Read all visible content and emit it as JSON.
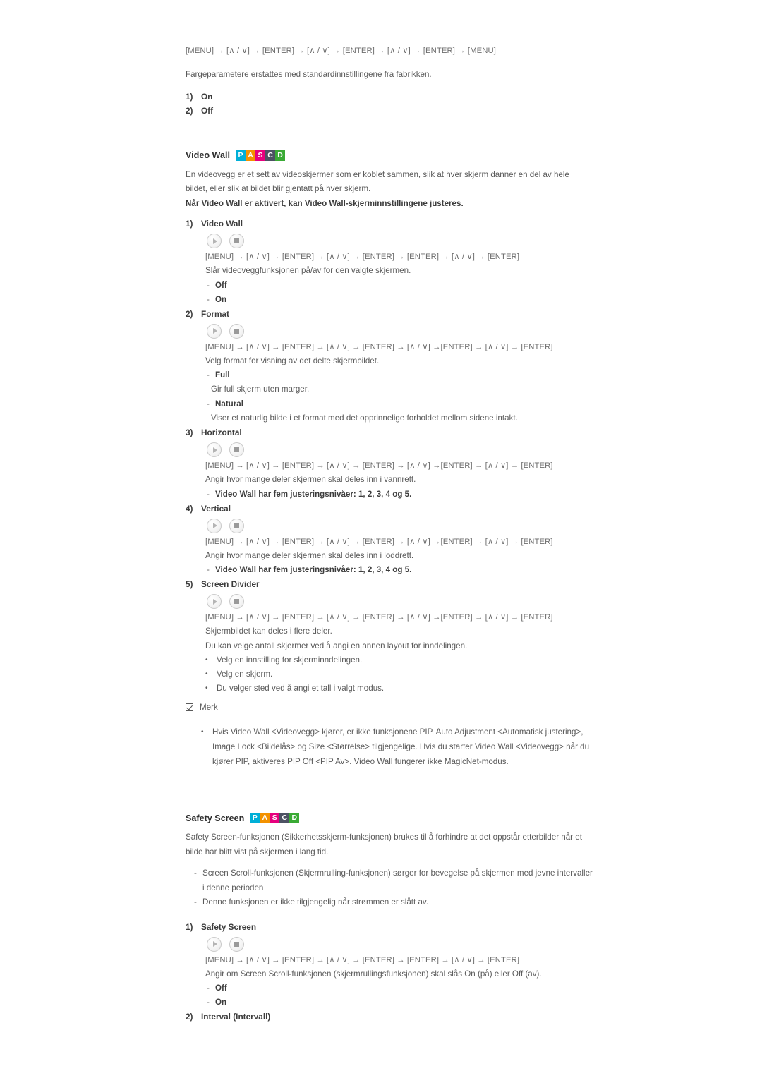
{
  "document": {
    "language": "Norwegian",
    "text_color": "#5a5a5a"
  },
  "badge": {
    "letters": [
      "P",
      "A",
      "S",
      "C",
      "D"
    ],
    "colors": [
      "#00AFD7",
      "#F39200",
      "#E6007E",
      "#4D5263",
      "#3AAA35"
    ]
  },
  "media_buttons": {
    "play_label": "play-button",
    "stop_label": "stop-button"
  },
  "top_section": {
    "keyseq": "[MENU] → [∧ / ∨] → [ENTER] → [∧ / ∨] → [ENTER] → [∧ / ∨] → [ENTER] → [MENU]",
    "description": "Fargeparametere erstattes med standardinnstillingene fra fabrikken.",
    "items": [
      {
        "num": "1)",
        "label": "On"
      },
      {
        "num": "2)",
        "label": "Off"
      }
    ]
  },
  "video_wall": {
    "title": "Video Wall",
    "intro_line_1": "En videovegg er et sett av videoskjermer som er koblet sammen, slik at hver skjerm danner en del av hele",
    "intro_line_2": "bildet, eller slik at bildet blir gjentatt på hver skjerm.",
    "intro_bold": "Når Video Wall er aktivert, kan Video Wall-skjerminnstillingene justeres.",
    "items": [
      {
        "num": "1)",
        "label": "Video Wall",
        "keyseq": "[MENU] → [∧ / ∨] → [ENTER] → [∧ / ∨] → [ENTER] → [ENTER] → [∧ / ∨] → [ENTER]",
        "description": "Slår videoveggfunksjonen på/av for den valgte skjermen.",
        "options": [
          {
            "label": "Off",
            "bold": true
          },
          {
            "label": "On",
            "bold": true
          }
        ]
      },
      {
        "num": "2)",
        "label": "Format",
        "keyseq": "[MENU] → [∧ / ∨] → [ENTER] → [∧ / ∨] → [ENTER] → [∧ / ∨] →[ENTER] → [∧ / ∨] → [ENTER]",
        "description": "Velg format for visning av det delte skjermbildet.",
        "options": [
          {
            "label": "Full",
            "bold": true,
            "detail": "Gir full skjerm uten marger."
          },
          {
            "label": "Natural",
            "bold": true,
            "detail": "Viser et naturlig bilde i et format med det opprinnelige forholdet mellom sidene intakt."
          }
        ]
      },
      {
        "num": "3)",
        "label": "Horizontal",
        "keyseq": "[MENU] → [∧ / ∨] → [ENTER] → [∧ / ∨] → [ENTER] → [∧ / ∨] →[ENTER] → [∧ / ∨] → [ENTER]",
        "description": "Angir hvor mange deler skjermen skal deles inn i vannrett.",
        "options": [
          {
            "label": "Video Wall har fem justeringsnivåer: 1, 2, 3, 4 og 5.",
            "bold": true
          }
        ]
      },
      {
        "num": "4)",
        "label": "Vertical",
        "keyseq": "[MENU] → [∧ / ∨] → [ENTER] → [∧ / ∨] → [ENTER] → [∧ / ∨] →[ENTER] → [∧ / ∨] → [ENTER]",
        "description": "Angir hvor mange deler skjermen skal deles inn i loddrett.",
        "options": [
          {
            "label": "Video Wall har fem justeringsnivåer: 1, 2, 3, 4 og 5.",
            "bold": true
          }
        ]
      },
      {
        "num": "5)",
        "label": "Screen Divider",
        "keyseq": "[MENU] → [∧ / ∨] → [ENTER] → [∧ / ∨] → [ENTER] → [∧ / ∨] →[ENTER] → [∧ / ∨] → [ENTER]",
        "description": "Skjermbildet kan deles i flere deler.",
        "description_2": "Du kan velge antall skjermer ved å angi en annen layout for inndelingen.",
        "bullets": [
          "Velg en innstilling for skjerminndelingen.",
          "Velg en skjerm.",
          "Du velger sted ved å angi et tall i valgt modus."
        ]
      }
    ],
    "note": {
      "title": "Merk",
      "body_line_1": "Hvis Video Wall <Videovegg> kjører, er ikke funksjonene PIP, Auto Adjustment <Automatisk justering>,",
      "body_line_2": "Image Lock <Bildelås> og Size <Størrelse> tilgjengelige. Hvis du starter Video Wall <Videovegg> når du",
      "body_line_3": "kjører PIP, aktiveres PIP Off <PIP Av>. Video Wall fungerer ikke MagicNet-modus."
    }
  },
  "safety_screen": {
    "title": "Safety Screen",
    "intro_line_1": "Safety Screen-funksjonen (Sikkerhetsskjerm-funksjonen) brukes til å forhindre at det oppstår etterbilder når et",
    "intro_line_2": "bilde har blitt vist på skjermen i lang tid.",
    "dashes": [
      "Screen Scroll-funksjonen (Skjermrulling-funksjonen) sørger for bevegelse på skjermen med jevne intervaller",
      "i denne perioden",
      "Denne funksjonen er ikke tilgjengelig når strømmen er slått av."
    ],
    "items": [
      {
        "num": "1)",
        "label": "Safety Screen",
        "keyseq": "[MENU] → [∧ / ∨] → [ENTER] → [∧ / ∨] → [ENTER] → [ENTER] → [∧ / ∨] → [ENTER]",
        "description": "Angir om Screen Scroll-funksjonen (skjermrullingsfunksjonen) skal slås On (på) eller Off (av).",
        "options": [
          {
            "label": "Off",
            "bold": true
          },
          {
            "label": "On",
            "bold": true
          }
        ]
      },
      {
        "num": "2)",
        "label": "Interval (Intervall)"
      }
    ]
  }
}
